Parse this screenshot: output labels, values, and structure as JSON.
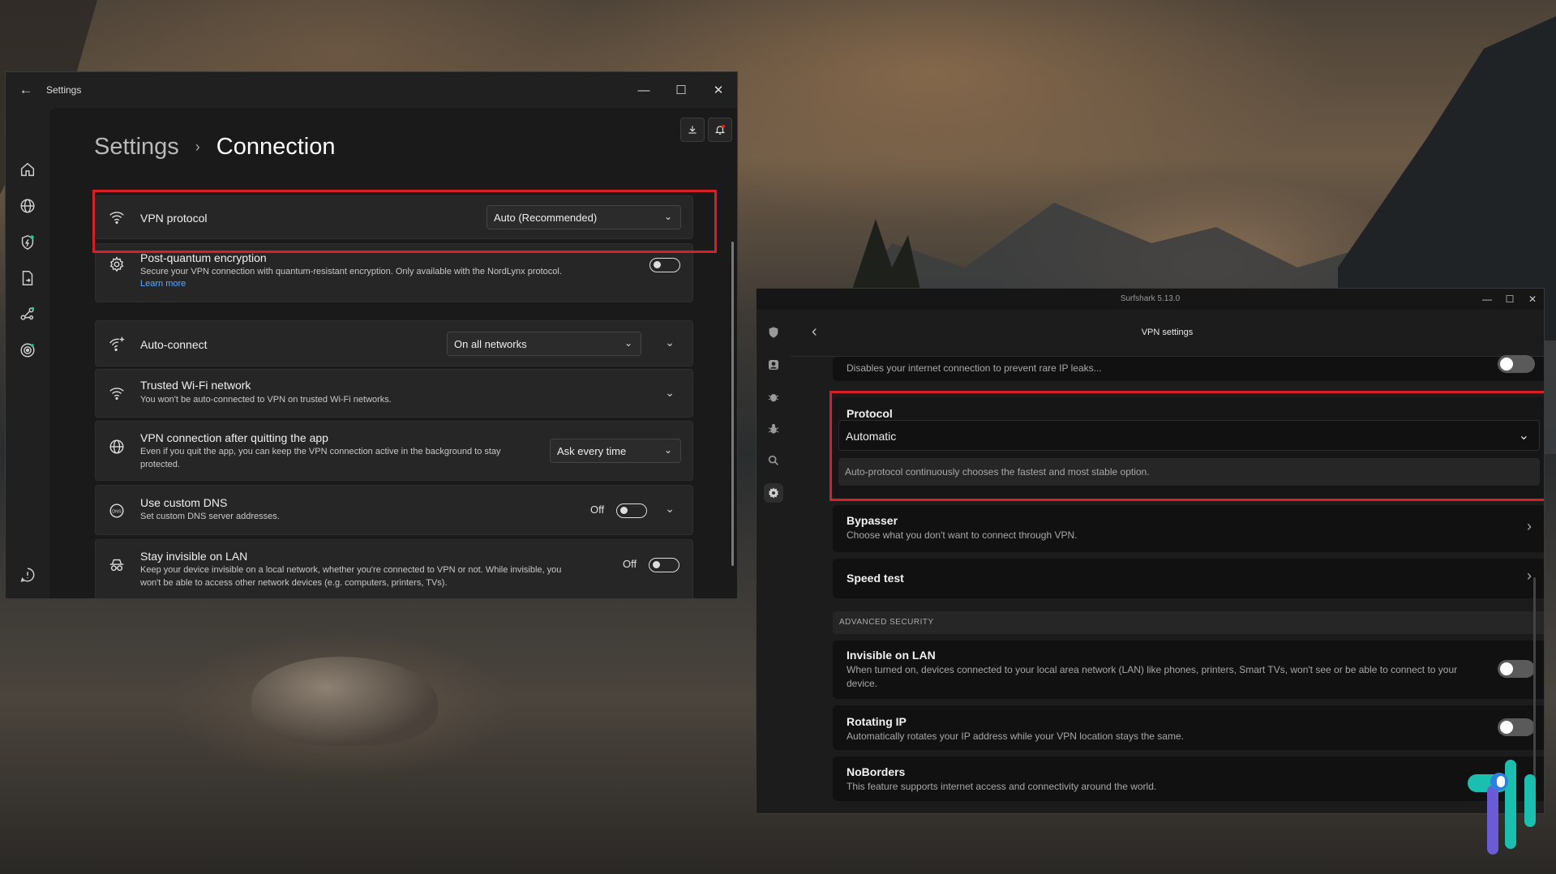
{
  "colors": {
    "highlight": "#d91f26",
    "nord_link": "#5fa8ff",
    "nord_notify_dot": "#e02020",
    "logo_teal": "#1bbfb0",
    "logo_blue": "#2f7fe0",
    "logo_purple": "#6c5bd6"
  },
  "nord": {
    "window_title": "Settings",
    "breadcrumb_root": "Settings",
    "breadcrumb_separator": "›",
    "breadcrumb_current": "Connection",
    "rail_icons": [
      "home-icon",
      "globe-icon",
      "shield-bolt-icon",
      "file-share-icon",
      "meshnet-icon",
      "target-icon",
      "help-icon",
      "settings-gear-icon"
    ],
    "vpn_protocol": {
      "title": "VPN protocol",
      "value": "Auto (Recommended)"
    },
    "post_quantum": {
      "title": "Post-quantum encryption",
      "desc": "Secure your VPN connection with quantum-resistant encryption. Only available with the NordLynx protocol.",
      "link": "Learn more",
      "enabled": false
    },
    "auto_connect": {
      "title": "Auto-connect",
      "value": "On all networks"
    },
    "trusted_wifi": {
      "title": "Trusted Wi-Fi network",
      "desc": "You won't be auto-connected to VPN on trusted Wi-Fi networks."
    },
    "after_quit": {
      "title": "VPN connection after quitting the app",
      "desc": "Even if you quit the app, you can keep the VPN connection active in the background to stay protected.",
      "value": "Ask every time"
    },
    "custom_dns": {
      "title": "Use custom DNS",
      "desc": "Set custom DNS server addresses.",
      "state": "Off"
    },
    "invisible_lan": {
      "title": "Stay invisible on LAN",
      "desc": "Keep your device invisible on a local network, whether you're connected to VPN or not. While invisible, you won't be able to access other network devices (e.g. computers, printers, TVs).",
      "state": "Off"
    }
  },
  "surf": {
    "window_title": "Surfshark 5.13.0",
    "page_title": "VPN settings",
    "rail_icons": [
      "shield-icon",
      "person-icon",
      "bug-alert-icon",
      "bug-icon",
      "search-icon",
      "gear-icon"
    ],
    "kill_switch_desc": "Disables your internet connection to prevent rare IP leaks...",
    "protocol": {
      "title": "Protocol",
      "value": "Automatic",
      "hint": "Auto-protocol continuously chooses the fastest and most stable option."
    },
    "bypasser": {
      "title": "Bypasser",
      "desc": "Choose what you don't want to connect through VPN."
    },
    "speed_test": {
      "title": "Speed test"
    },
    "advanced_header": "ADVANCED SECURITY",
    "invisible_lan": {
      "title": "Invisible on LAN",
      "desc": "When turned on, devices connected to your local area network (LAN) like phones, printers, Smart TVs, won't see or be able to connect to your device."
    },
    "rotating_ip": {
      "title": "Rotating IP",
      "desc": "Automatically rotates your IP address while your VPN location stays the same."
    },
    "noborders": {
      "title": "NoBorders",
      "desc": "This feature supports internet access and connectivity around the world."
    }
  }
}
